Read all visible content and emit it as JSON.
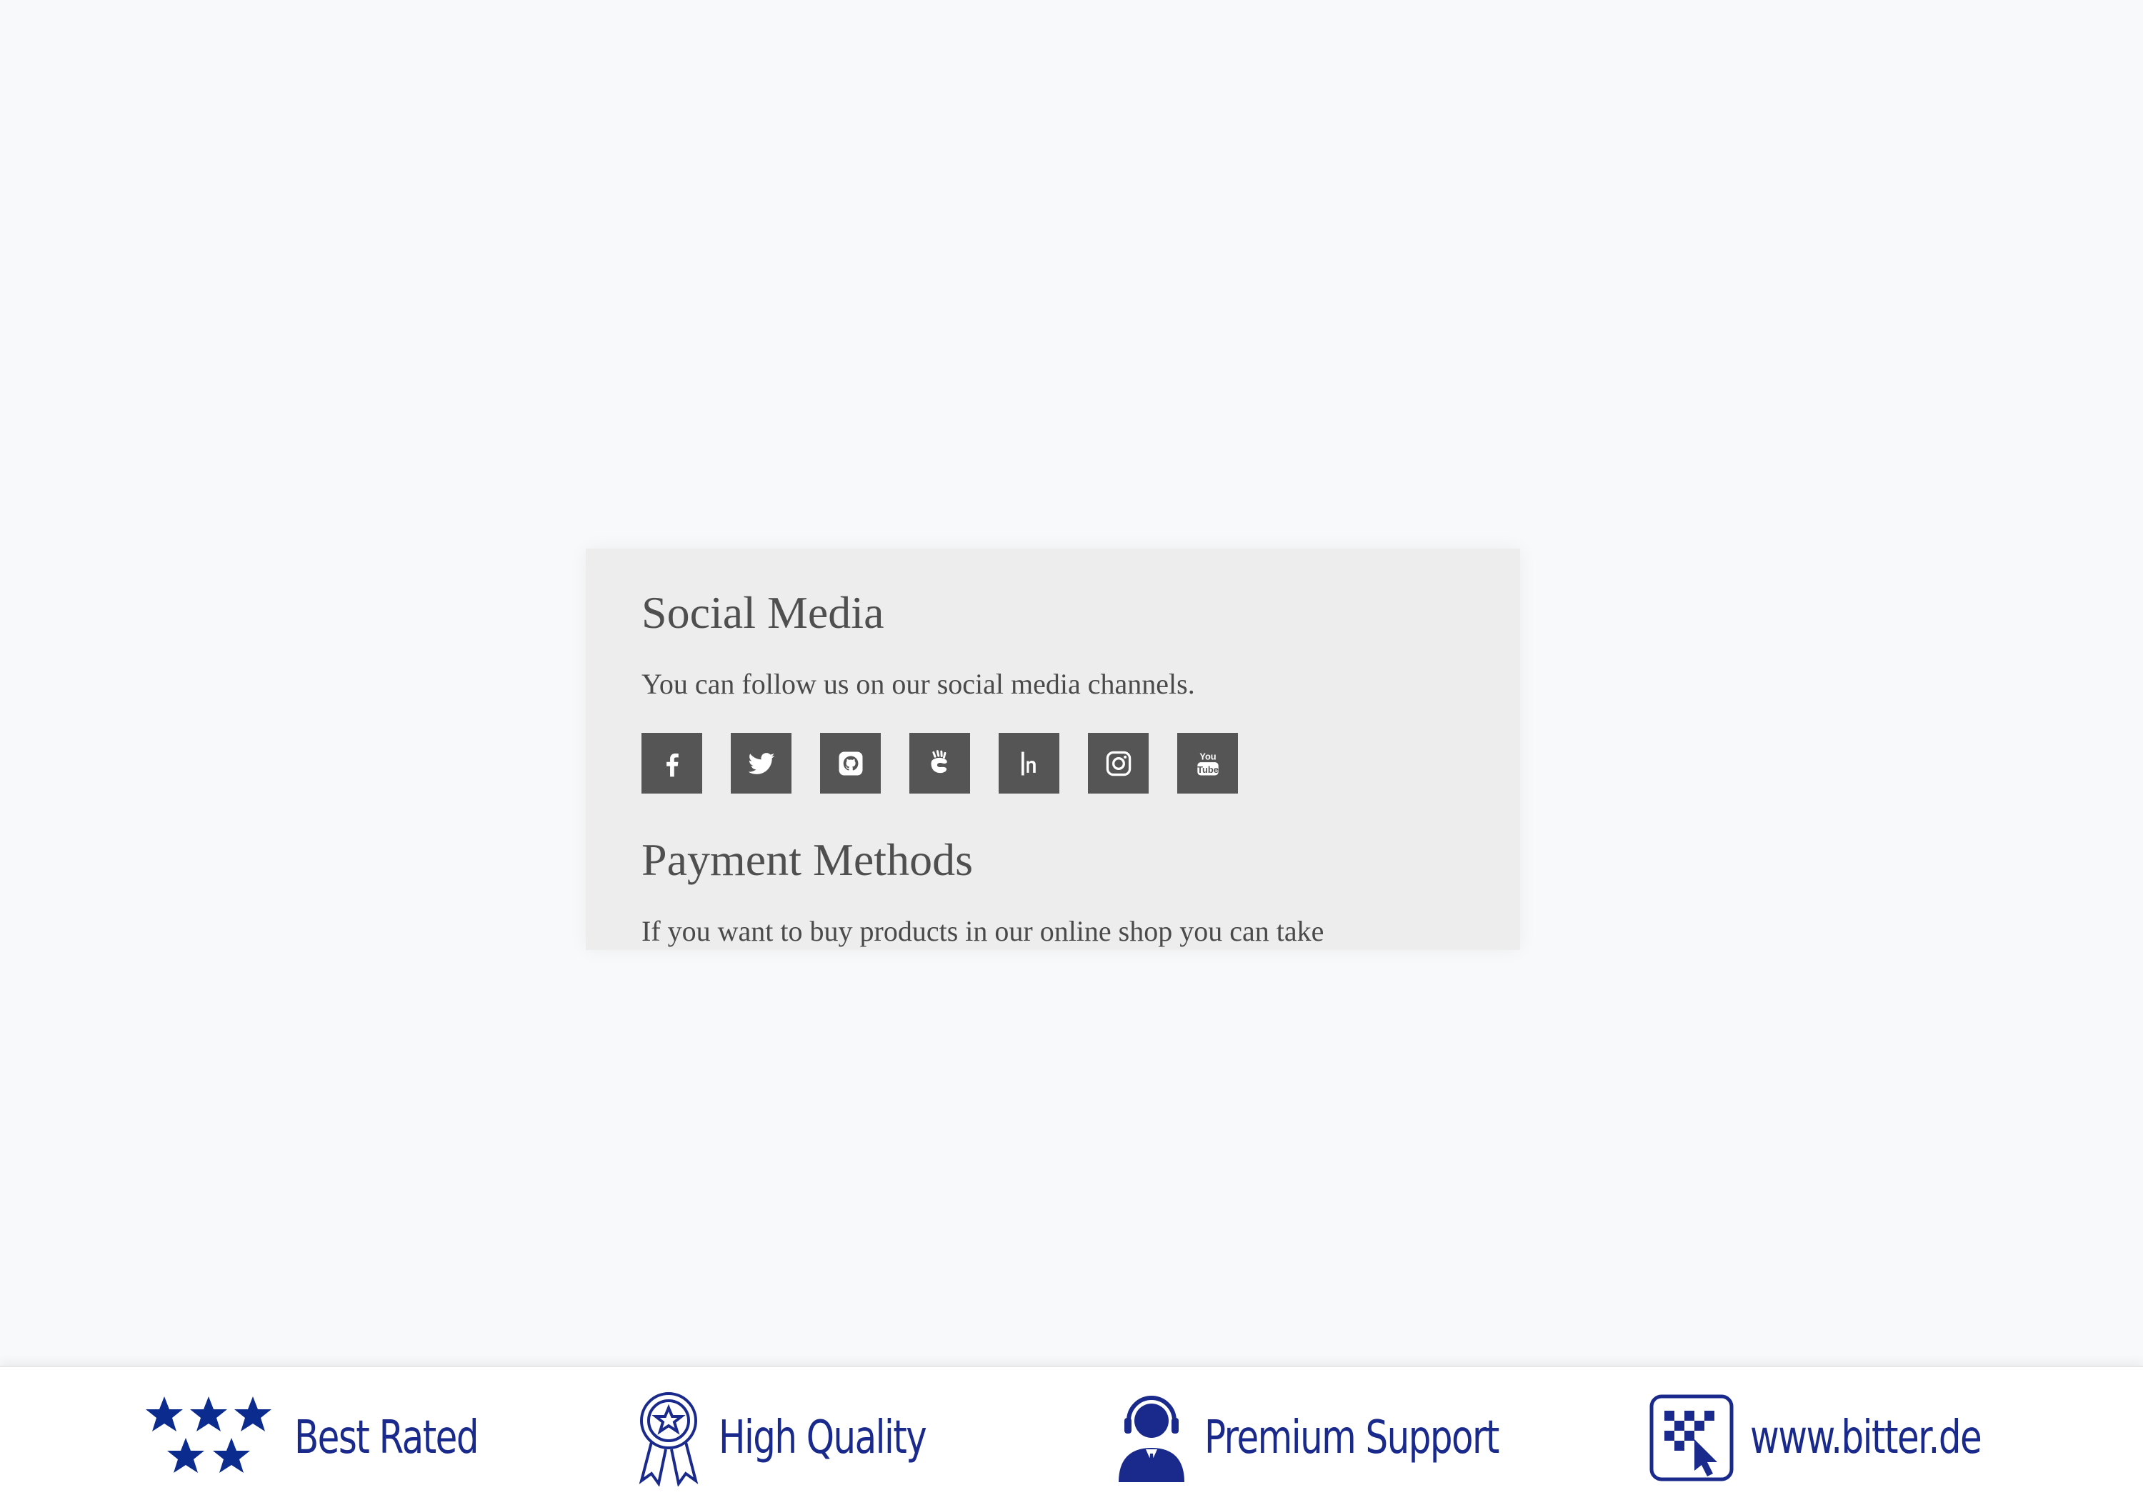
{
  "social": {
    "title": "Social Media",
    "description": "You can follow us on our social media channels.",
    "icons": [
      "facebook-icon",
      "twitter-icon",
      "github-icon",
      "concrete5-icon",
      "hubspot-icon",
      "instagram-icon",
      "youtube-icon"
    ]
  },
  "payment": {
    "title": "Payment Methods",
    "description": "If you want to buy products in our online shop you can take"
  },
  "footer": {
    "badges": [
      {
        "icon": "stars-icon",
        "label": "Best Rated"
      },
      {
        "icon": "award-ribbon-icon",
        "label": "High Quality"
      },
      {
        "icon": "support-agent-icon",
        "label": "Premium Support"
      },
      {
        "icon": "website-cursor-icon",
        "label": "www.bitter.de"
      }
    ]
  },
  "colors": {
    "background": "#f8f9fa",
    "card": "#ededed",
    "icon_tile": "#555555",
    "badge_blue": "#1a2a8c",
    "badge_blue_dark": "#0b2b8f"
  },
  "youtube_icon_text": {
    "top": "You",
    "bottom": "Tube"
  }
}
